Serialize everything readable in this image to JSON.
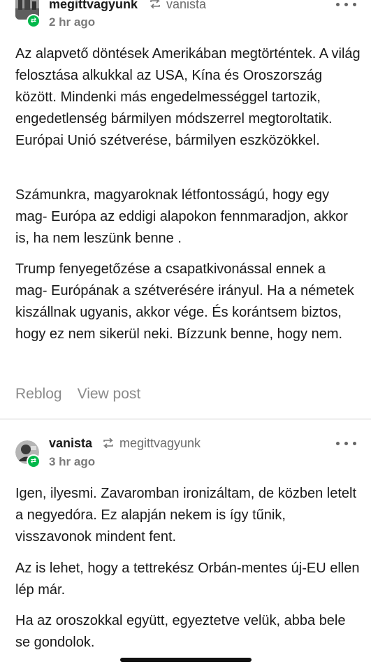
{
  "posts": [
    {
      "author": "megittvagyunk",
      "reblogged_from": "vanista",
      "time": "2 hr ago",
      "paragraphs": [
        "Az alapvető döntések Amerikában megtörténtek. A világ felosztása alkukkal az USA, Kína és Oroszország között. Mindenki más engedelmességgel tartozik, engedetlenség bármilyen módszerrel megtoroltatik. Európai Unió szétverése, bármilyen eszközökkel.",
        "Számunkra, magyaroknak létfontosságú, hogy egy mag- Európa az eddigi alapokon fennmaradjon, akkor is, ha nem leszünk benne .",
        "Trump fenyegetőzése a csapatkivonással ennek a mag- Európának a szétverésére irányul. Ha a németek kiszállnak ugyanis, akkor vége. És korántsem biztos, hogy ez nem sikerül neki. Bízzunk benne, hogy nem."
      ],
      "actions": {
        "reblog": "Reblog",
        "view_post": "View post"
      }
    },
    {
      "author": "vanista",
      "reblogged_from": "megittvagyunk",
      "time": "3 hr ago",
      "paragraphs": [
        "Igen, ilyesmi. Zavaromban ironizáltam, de közben letelt a negyedóra. Ez alapján nekem is így tűnik, visszavonok mindent fent.",
        "Az is lehet, hogy a tettrekész Orbán-mentes új-EU ellen lép már.",
        "Ha az oroszokkal együtt, egyeztetve velük, abba bele se gondolok."
      ]
    }
  ],
  "colors": {
    "accent_green": "#00b84a",
    "muted_text": "#7a7a7a",
    "action_text": "#8a8a8a"
  }
}
